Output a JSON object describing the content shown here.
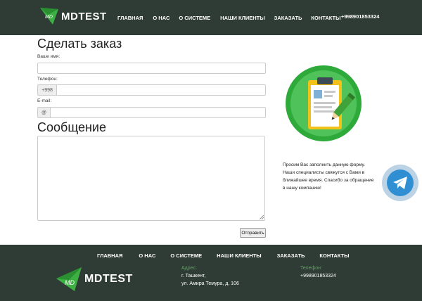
{
  "header": {
    "logo_text": "MDTEST",
    "logo_mark": "MD",
    "nav": [
      "ГЛАВНАЯ",
      "О НАС",
      "О СИСТЕМЕ",
      "НАШИ КЛИЕНТЫ",
      "ЗАКАЗАТЬ",
      "КОНТАКТЫ"
    ],
    "phone": "+998901853324"
  },
  "form": {
    "title": "Сделать заказ",
    "name_label": "Ваше имя:",
    "phone_label": "Телефон:",
    "phone_prefix": "+998",
    "email_label": "E-mail:",
    "email_prefix": "@",
    "message_title": "Сообщение",
    "submit_label": "Отправить"
  },
  "side": {
    "text": "Просим Вас заполнить данную форму. Наши специалисты свяжутся с Вами в ближайшее время. Спасибо за обращение в нашу компанию!"
  },
  "footer": {
    "nav": [
      "ГЛАВНАЯ",
      "О НАС",
      "О СИСТЕМЕ",
      "НАШИ КЛИЕНТЫ",
      "ЗАКАЗАТЬ",
      "КОНТАКТЫ"
    ],
    "logo_text": "MDTEST",
    "logo_mark": "MD",
    "address_heading": "Адрес:",
    "address_line1": "г. Ташкент,",
    "address_line2": "ул. Амира Темура, д. 106",
    "phone_heading": "Телефон:",
    "phone": "+998901853324"
  },
  "colors": {
    "header_bg": "#2f3b35",
    "brand_green": "#2eaa3a",
    "telegram_blue": "#2f8fd2"
  }
}
